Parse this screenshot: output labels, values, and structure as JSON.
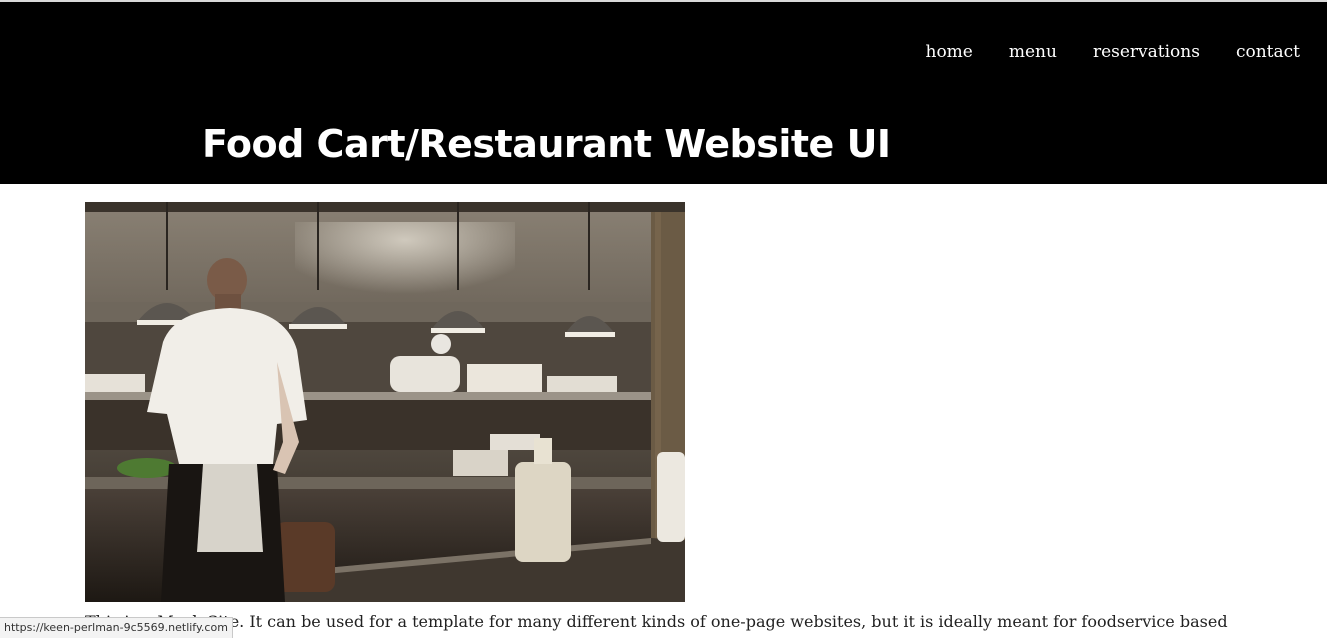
{
  "nav": {
    "items": [
      {
        "label": "home"
      },
      {
        "label": "menu"
      },
      {
        "label": "reservations"
      },
      {
        "label": "contact"
      }
    ]
  },
  "header": {
    "title": "Food Cart/Restaurant Website UI"
  },
  "hero": {
    "subject": "restaurant kitchen with chefs under hanging pendant lamps"
  },
  "main": {
    "intro_text": "This is a Mock Site. It can be used for a template for many different kinds of one-page websites, but it is ideally meant for foodservice based"
  },
  "status_bar": {
    "url": "https://keen-perlman-9c5569.netlify.com"
  },
  "colors": {
    "header_bg": "#000000",
    "header_text": "#ffffff",
    "page_bg": "#ffffff"
  }
}
